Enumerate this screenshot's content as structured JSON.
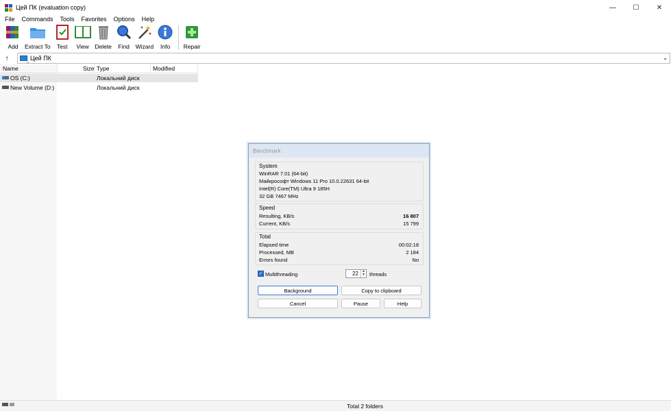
{
  "window": {
    "title": "Цей ПК (evaluation copy)",
    "controls": [
      "minimize",
      "maximize",
      "close"
    ]
  },
  "menu": [
    "File",
    "Commands",
    "Tools",
    "Favorites",
    "Options",
    "Help"
  ],
  "toolbar": [
    {
      "label": "Add",
      "icon": "archive-books-icon"
    },
    {
      "label": "Extract To",
      "icon": "folder-extract-icon"
    },
    {
      "label": "Test",
      "icon": "test-clipboard-icon"
    },
    {
      "label": "View",
      "icon": "book-view-icon"
    },
    {
      "label": "Delete",
      "icon": "trash-icon"
    },
    {
      "label": "Find",
      "icon": "magnifier-icon"
    },
    {
      "label": "Wizard",
      "icon": "wand-icon"
    },
    {
      "label": "Info",
      "icon": "info-icon"
    },
    {
      "label": "Repair",
      "icon": "repair-kit-icon"
    }
  ],
  "address": {
    "path": "Цей ПК"
  },
  "columns": [
    "Name",
    "Size",
    "Type",
    "Modified"
  ],
  "files": [
    {
      "name": "OS (C:)",
      "size": "",
      "type": "Локальний диск",
      "modified": ""
    },
    {
      "name": "New Volume (D:)",
      "size": "",
      "type": "Локальний диск",
      "modified": ""
    }
  ],
  "status": {
    "text": "Total 2 folders"
  },
  "benchmark": {
    "title": "Benchmark",
    "system": {
      "title": "System",
      "lines": [
        "WinRAR 7.01 (64-bit)",
        "Майкрософт Windows 11 Pro 10.0.22631 64-bit",
        "Intel(R) Core(TM) Ultra 9 185H",
        "32 GB  7467 MHz"
      ]
    },
    "speed": {
      "title": "Speed",
      "rows": [
        {
          "label": "Resulting, KB/s",
          "value": "16 807"
        },
        {
          "label": "Current, KB/s",
          "value": "15 799"
        }
      ]
    },
    "total": {
      "title": "Total",
      "rows": [
        {
          "label": "Elapsed time",
          "value": "00:02:18"
        },
        {
          "label": "Processed, MB",
          "value": "2 184"
        },
        {
          "label": "Errors found",
          "value": "No"
        }
      ]
    },
    "multithreading": {
      "label": "Multithreading",
      "checked": true
    },
    "threads": {
      "value": "22",
      "label": "threads"
    },
    "buttons": {
      "background": "Background",
      "copy": "Copy to clipboard",
      "cancel": "Cancel",
      "pause": "Pause",
      "help": "Help"
    }
  }
}
